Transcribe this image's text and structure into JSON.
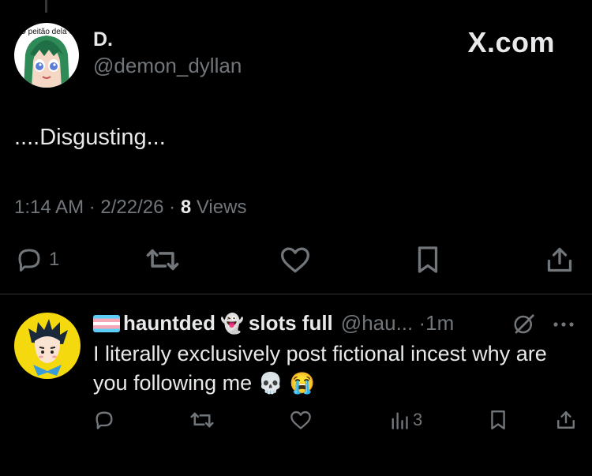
{
  "tweet": {
    "avatar_caption": "O peitão dela ó",
    "display_name": "D.",
    "handle": "@demon_dyllan",
    "brand": "X.com",
    "text": "....Disgusting...",
    "time": "1:14 AM",
    "date": "2/22/26",
    "views_count": "8",
    "views_label": "Views",
    "reply_count": "1",
    "icons": {
      "reply": "reply-icon",
      "retweet": "retweet-icon",
      "like": "heart-icon",
      "bookmark": "bookmark-icon",
      "share": "share-icon"
    }
  },
  "reply": {
    "display_name_part1": "hauntded",
    "ghost_emoji": "👻",
    "display_name_part2": "slots full",
    "handle": "@hau...",
    "separator": "·",
    "age": "1m",
    "text": "I literally exclusively post fictional incest why are you following me",
    "emoji_skull": "💀",
    "emoji_cry": "😭",
    "views_count": "3"
  },
  "colors": {
    "background": "#000000",
    "text_primary": "#e7e9ea",
    "text_secondary": "#71767b",
    "divider": "#2f3336"
  }
}
